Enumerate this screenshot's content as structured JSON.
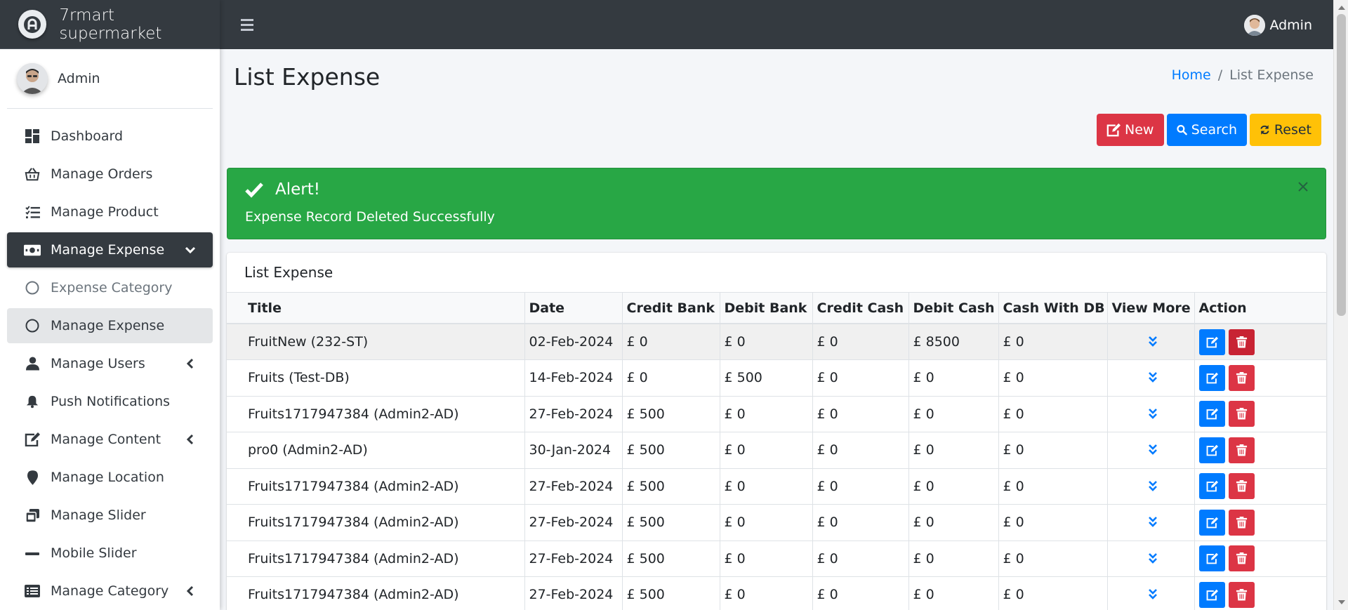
{
  "app": {
    "brand": "7rmart supermarket",
    "user": "Admin"
  },
  "topbar": {
    "user": "Admin"
  },
  "sidebar": {
    "items": [
      {
        "label": "Dashboard",
        "icon": "dashboard-icon"
      },
      {
        "label": "Manage Orders",
        "icon": "basket-icon"
      },
      {
        "label": "Manage Product",
        "icon": "tasks-list-icon"
      },
      {
        "label": "Manage Expense",
        "icon": "money-bill-icon",
        "active": true
      },
      {
        "label": "Expense Category",
        "icon": "circle-icon"
      },
      {
        "label": "Manage Expense",
        "icon": "circle-icon",
        "current": true
      },
      {
        "label": "Manage Users",
        "icon": "user-icon"
      },
      {
        "label": "Push Notifications",
        "icon": "bell-icon"
      },
      {
        "label": "Manage Content",
        "icon": "edit-icon"
      },
      {
        "label": "Manage Location",
        "icon": "map-marker-icon"
      },
      {
        "label": "Manage Slider",
        "icon": "images-icon"
      },
      {
        "label": "Mobile Slider",
        "icon": "minus-icon"
      },
      {
        "label": "Manage Category",
        "icon": "list-alt-icon"
      }
    ]
  },
  "page": {
    "title": "List Expense"
  },
  "breadcrumb": {
    "home": "Home",
    "separator": "/",
    "current": "List Expense"
  },
  "toolbar": {
    "new_label": "New",
    "search_label": "Search",
    "reset_label": "Reset"
  },
  "alert": {
    "title": "Alert!",
    "message": "Expense Record Deleted Successfully"
  },
  "card": {
    "title": "List Expense"
  },
  "table": {
    "columns": [
      "Title",
      "Date",
      "Credit Bank",
      "Debit Bank",
      "Credit Cash",
      "Debit Cash",
      "Cash With DB",
      "View More",
      "Action"
    ],
    "rows": [
      [
        "FruitNew (232-ST)",
        "02-Feb-2024",
        "£ 0",
        "£ 0",
        "£ 0",
        "£ 8500",
        "£ 0"
      ],
      [
        "Fruits (Test-DB)",
        "14-Feb-2024",
        "£ 0",
        "£ 500",
        "£ 0",
        "£ 0",
        "£ 0"
      ],
      [
        "Fruits1717947384 (Admin2-AD)",
        "27-Feb-2024",
        "£ 500",
        "£ 0",
        "£ 0",
        "£ 0",
        "£ 0"
      ],
      [
        "pro0 (Admin2-AD)",
        "30-Jan-2024",
        "£ 500",
        "£ 0",
        "£ 0",
        "£ 0",
        "£ 0"
      ],
      [
        "Fruits1717947384 (Admin2-AD)",
        "27-Feb-2024",
        "£ 500",
        "£ 0",
        "£ 0",
        "£ 0",
        "£ 0"
      ],
      [
        "Fruits1717947384 (Admin2-AD)",
        "27-Feb-2024",
        "£ 500",
        "£ 0",
        "£ 0",
        "£ 0",
        "£ 0"
      ],
      [
        "Fruits1717947384 (Admin2-AD)",
        "27-Feb-2024",
        "£ 500",
        "£ 0",
        "£ 0",
        "£ 0",
        "£ 0"
      ],
      [
        "Fruits1717947384 (Admin2-AD)",
        "27-Feb-2024",
        "£ 500",
        "£ 0",
        "£ 0",
        "£ 0",
        "£ 0"
      ]
    ]
  },
  "colors": {
    "topbar": "#343a40",
    "danger": "#dc3545",
    "primary": "#007bff",
    "warning": "#ffc107",
    "success": "#28a745"
  }
}
